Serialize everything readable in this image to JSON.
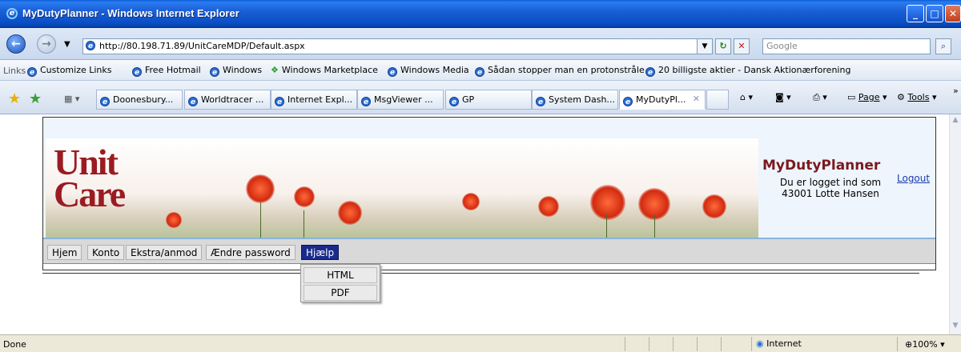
{
  "window": {
    "title": "MyDutyPlanner - Windows Internet Explorer"
  },
  "address": {
    "url": "http://80.198.71.89/UnitCareMDP/Default.aspx",
    "search_placeholder": "Google"
  },
  "links_bar": {
    "label": "Links",
    "items": [
      "Customize Links",
      "Free Hotmail",
      "Windows",
      "Windows Marketplace",
      "Windows Media",
      "Sådan stopper man en protonstråle",
      "20 billigste aktier - Dansk Aktionærforening"
    ]
  },
  "tabs": [
    {
      "label": "Doonesbury..."
    },
    {
      "label": "Worldtracer ..."
    },
    {
      "label": "Internet Expl..."
    },
    {
      "label": "MsgViewer ..."
    },
    {
      "label": "GP"
    },
    {
      "label": "System Dash..."
    },
    {
      "label": "MyDutyPl...",
      "active": true
    }
  ],
  "command_bar": {
    "page": "Page",
    "tools": "Tools"
  },
  "page": {
    "logo_line1": "Unit",
    "logo_line2": "Care",
    "app_name": "MyDutyPlanner",
    "logged_in_line1": "Du er logget ind som",
    "logged_in_line2": "43001 Lotte Hansen",
    "logout": "Logout",
    "menu": [
      "Hjem",
      "Konto",
      "Ekstra/anmod",
      "Ændre password",
      "Hjælp"
    ],
    "active_menu": "Hjælp",
    "dropdown": [
      "HTML",
      "PDF"
    ]
  },
  "status": {
    "text": "Done",
    "zone": "Internet",
    "zoom": "100%"
  },
  "colors": {
    "menu_active_bg": "#1a2a8c",
    "app_name": "#7a1a20",
    "logo": "#9b1b22"
  }
}
